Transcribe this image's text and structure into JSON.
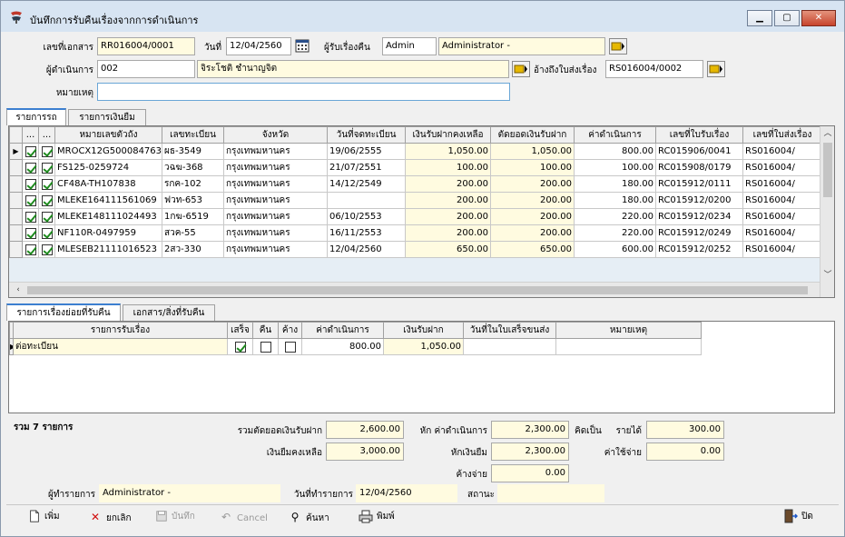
{
  "window": {
    "title": "บันทึกการรับคืนเรื่องจากการดำเนินการ"
  },
  "header": {
    "doc_no_label": "เลขที่เอกสาร",
    "doc_no": "RR016004/0001",
    "date_label": "วันที่",
    "date": "12/04/2560",
    "receiver_label": "ผู้รับเรื่องคืน",
    "receiver_code": "Admin",
    "receiver_name": "Administrator -",
    "operator_label": "ผู้ดำเนินการ",
    "operator_code": "002",
    "operator_name": "จิระโชติ ชำนาญจิต",
    "ref_label": "อ้างถึงใบส่งเรื่อง",
    "ref_no": "RS016004/0002",
    "note_label": "หมายเหตุ",
    "note": ""
  },
  "tabs_top": [
    "รายการรถ",
    "รายการเงินยืม"
  ],
  "cars": {
    "columns": [
      "...",
      "...",
      "หมายเลขตัวถัง",
      "เลขทะเบียน",
      "จังหวัด",
      "วันที่จดทะเบียน",
      "เงินรับฝากคงเหลือ",
      "ตัดยอดเงินรับฝาก",
      "ค่าดำเนินการ",
      "เลขที่ใบรับเรื่อง",
      "เลขที่ใบส่งเรื่อง"
    ],
    "rows": [
      {
        "chassis": "MROCX12G500084763",
        "plate": "ผธ-3549",
        "province": "กรุงเทพมหานคร",
        "reg_date": "19/06/2555",
        "deposit_left": "1,050.00",
        "deposit_cut": "1,050.00",
        "fee": "800.00",
        "recv_no": "RC015906/0041",
        "send_no": "RS016004/"
      },
      {
        "chassis": "FS125-0259724",
        "plate": "วฉฆ-368",
        "province": "กรุงเทพมหานคร",
        "reg_date": "21/07/2551",
        "deposit_left": "100.00",
        "deposit_cut": "100.00",
        "fee": "100.00",
        "recv_no": "RC015908/0179",
        "send_no": "RS016004/"
      },
      {
        "chassis": "CF48A-TH107838",
        "plate": "รกค-102",
        "province": "กรุงเทพมหานคร",
        "reg_date": "14/12/2549",
        "deposit_left": "200.00",
        "deposit_cut": "200.00",
        "fee": "180.00",
        "recv_no": "RC015912/0111",
        "send_no": "RS016004/"
      },
      {
        "chassis": "MLEKE164111561069",
        "plate": "ฟวท-653",
        "province": "กรุงเทพมหานคร",
        "reg_date": "",
        "deposit_left": "200.00",
        "deposit_cut": "200.00",
        "fee": "180.00",
        "recv_no": "RC015912/0200",
        "send_no": "RS016004/"
      },
      {
        "chassis": "MLEKE148111024493",
        "plate": "1กฆ-6519",
        "province": "กรุงเทพมหานคร",
        "reg_date": "06/10/2553",
        "deposit_left": "200.00",
        "deposit_cut": "200.00",
        "fee": "220.00",
        "recv_no": "RC015912/0234",
        "send_no": "RS016004/"
      },
      {
        "chassis": "NF110R-0497959",
        "plate": "สวค-55",
        "province": "กรุงเทพมหานคร",
        "reg_date": "16/11/2553",
        "deposit_left": "200.00",
        "deposit_cut": "200.00",
        "fee": "220.00",
        "recv_no": "RC015912/0249",
        "send_no": "RS016004/"
      },
      {
        "chassis": "MLESEB21111016523",
        "plate": "2สว-330",
        "province": "กรุงเทพมหานคร",
        "reg_date": "12/04/2560",
        "deposit_left": "650.00",
        "deposit_cut": "650.00",
        "fee": "600.00",
        "recv_no": "RC015912/0252",
        "send_no": "RS016004/"
      }
    ]
  },
  "tabs_bottom": [
    "รายการเรื่องย่อยที่รับคืน",
    "เอกสาร/สิ่งที่รับคืน"
  ],
  "subitems": {
    "columns": [
      "รายการรับเรื่อง",
      "เสร็จ",
      "คืน",
      "ค้าง",
      "ค่าดำเนินการ",
      "เงินรับฝาก",
      "วันที่ในใบเสร็จขนส่ง",
      "หมายเหตุ"
    ],
    "rows": [
      {
        "item": "ต่อทะเบียน",
        "done": true,
        "returned": false,
        "pending": false,
        "fee": "800.00",
        "deposit": "1,050.00",
        "receipt_date": "",
        "note": ""
      }
    ]
  },
  "summary": {
    "total_label": "รวม 7 รายการ",
    "cut_total_label": "รวมตัดยอดเงินรับฝาก",
    "cut_total": "2,600.00",
    "minus_fee_label": "หัก ค่าดำเนินการ",
    "minus_fee": "2,300.00",
    "as_label": "คิดเป็น",
    "income_label": "รายได้",
    "income": "300.00",
    "loan_left_label": "เงินยืมคงเหลือ",
    "loan_left": "3,000.00",
    "minus_loan_label": "หักเงินยืม",
    "minus_loan": "2,300.00",
    "expense_label": "ค่าใช้จ่าย",
    "expense": "0.00",
    "pending_label": "ค้างจ่าย",
    "pending": "0.00"
  },
  "footer": {
    "made_by_label": "ผู้ทำรายการ",
    "made_by": "Administrator -",
    "made_date_label": "วันที่ทำรายการ",
    "made_date": "12/04/2560",
    "status_label": "สถานะ",
    "status": ""
  },
  "toolbar": {
    "add": "เพิ่ม",
    "cancel_doc": "ยกเลิก",
    "save": "บันทึก",
    "cancel": "Cancel",
    "search": "ค้นหา",
    "print": "พิมพ์",
    "close": "ปิด"
  }
}
